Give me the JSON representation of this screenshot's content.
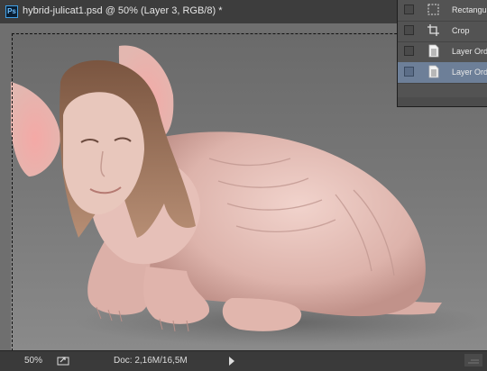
{
  "document": {
    "app_icon_text": "Ps",
    "title": "hybrid-julicat1.psd @ 50% (Layer 3, RGB/8) *"
  },
  "history": {
    "items": [
      {
        "label": "Rectangu",
        "icon": "rect-marquee-icon",
        "selected": false
      },
      {
        "label": "Crop",
        "icon": "crop-icon",
        "selected": false
      },
      {
        "label": "Layer Ord",
        "icon": "document-icon",
        "selected": false
      },
      {
        "label": "Layer Ord",
        "icon": "document-icon",
        "selected": true
      }
    ]
  },
  "status": {
    "zoom": "50%",
    "doc_size": "Doc: 2,16M/16,5M"
  },
  "colors": {
    "app_bg": "#282828",
    "panel_bg": "#535353",
    "selected_row": "#6d7f98",
    "canvas_bg": "#777777",
    "skin": "#e6c2bb"
  }
}
